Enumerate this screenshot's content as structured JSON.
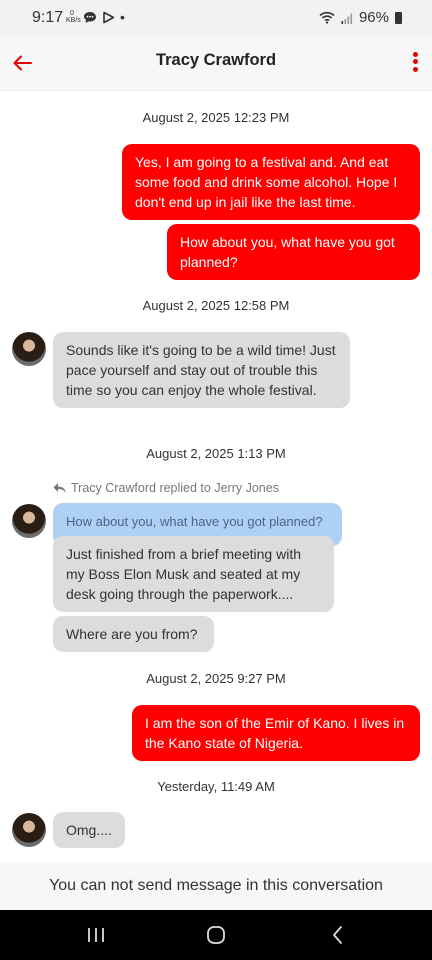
{
  "status_bar": {
    "time": "9:17",
    "net_speed_value": "0",
    "net_speed_unit": "KB/s",
    "battery": "96%"
  },
  "header": {
    "title": "Tracy Crawford",
    "back_icon": "arrow-left-icon",
    "menu_icon": "more-vertical-icon",
    "accent_color": "#e60000"
  },
  "messages": {
    "ts1": "August 2, 2025 12:23 PM",
    "m1": "Yes, I am going to a festival and. And eat some food and drink some alcohol. Hope I don't end up in jail like the last time.",
    "m2": "How about you, what have you got planned?",
    "ts2": "August 2, 2025 12:58 PM",
    "m3": "Sounds like it's going to be a wild time! Just pace yourself and stay out of trouble this time so you can enjoy the whole festival.",
    "ts3": "August 2, 2025 1:13 PM",
    "reply_note": "Tracy Crawford replied to Jerry Jones",
    "quoted": "How about you, what have you got planned?",
    "m4": "Just finished from a brief meeting with my Boss Elon Musk and seated at my desk going through the paperwork....",
    "m5": "Where are you from?",
    "ts4": "August 2, 2025 9:27 PM",
    "m6": "I am the son of the Emir of Kano.  I lives in the Kano state of Nigeria.",
    "ts5": "Yesterday, 11:49 AM",
    "m7": "Omg...."
  },
  "footer": {
    "notice": "You can not send message in this conversation"
  },
  "colors": {
    "sent_bubble": "#ff0000",
    "received_bubble": "#dcdcdc",
    "quote_bubble": "#aed0f5"
  }
}
